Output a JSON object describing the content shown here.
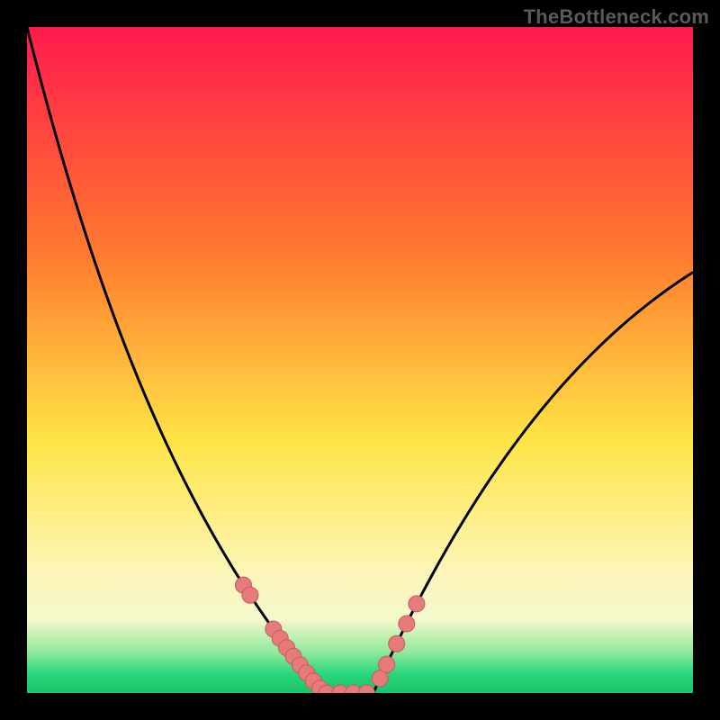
{
  "watermark": "TheBottleneck.com",
  "colors": {
    "top": "#ff1a4d",
    "mid1": "#ff7a2e",
    "mid2": "#ffe446",
    "pale1": "#fcf6b8",
    "pale2": "#f4f8cc",
    "green1": "#8de89a",
    "green2": "#2bd77d",
    "bottom": "#18c46a",
    "marker_fill": "#e77a7a",
    "marker_stroke": "#c75a57",
    "curve": "#000000"
  },
  "chart_data": {
    "type": "line",
    "title": "",
    "xlabel": "",
    "ylabel": "",
    "xlim": [
      0,
      100
    ],
    "ylim": [
      0,
      100
    ],
    "grid": false,
    "x": [
      0,
      1,
      2,
      3,
      4,
      5,
      6,
      7,
      8,
      9,
      10,
      11,
      12,
      13,
      14,
      15,
      16,
      17,
      18,
      19,
      20,
      21,
      22,
      23,
      24,
      25,
      26,
      27,
      28,
      29,
      30,
      31,
      32,
      33,
      34,
      35,
      36,
      37,
      38,
      39,
      40,
      41,
      42,
      43,
      44,
      45,
      46,
      47,
      48,
      49,
      50,
      51,
      52,
      53,
      54,
      55,
      56,
      57,
      58,
      59,
      60,
      61,
      62,
      63,
      64,
      65,
      66,
      67,
      68,
      69,
      70,
      71,
      72,
      73,
      74,
      75,
      76,
      77,
      78,
      79,
      80,
      81,
      82,
      83,
      84,
      85,
      86,
      87,
      88,
      89,
      90,
      91,
      92,
      93,
      94,
      95,
      96,
      97,
      98,
      99,
      100
    ],
    "left_curve_y": [
      100.0,
      96.05,
      92.22,
      88.49,
      84.88,
      81.36,
      77.95,
      74.64,
      71.42,
      68.3,
      65.27,
      62.33,
      59.48,
      56.71,
      54.02,
      51.42,
      48.89,
      46.43,
      44.05,
      41.74,
      39.49,
      37.31,
      35.19,
      33.13,
      31.14,
      29.19,
      27.3,
      25.47,
      23.68,
      21.94,
      20.25,
      18.6,
      17.0,
      15.43,
      13.91,
      12.42,
      10.98,
      9.56,
      8.19,
      6.84,
      5.53,
      4.25,
      3.0,
      1.79,
      0.6,
      0.0,
      0.0,
      0.0,
      0.0,
      0.0,
      0.0,
      0.0,
      0.0,
      0.0,
      0.0,
      0.0,
      0.0,
      0.0,
      0.0,
      0.0,
      0.0,
      0.0,
      0.0,
      0.0,
      0.0,
      0.0,
      0.0,
      0.0,
      0.0,
      0.0,
      0.0,
      0.0,
      0.0,
      0.0,
      0.0,
      0.0,
      0.0,
      0.0,
      0.0,
      0.0,
      0.0,
      0.0,
      0.0,
      0.0,
      0.0,
      0.0,
      0.0,
      0.0,
      0.0,
      0.0,
      0.0,
      0.0,
      0.0,
      0.0,
      0.0,
      0.0,
      0.0,
      0.0,
      0.0,
      0.0,
      0.0
    ],
    "right_curve_y": [
      0.0,
      0.0,
      0.0,
      0.0,
      0.0,
      0.0,
      0.0,
      0.0,
      0.0,
      0.0,
      0.0,
      0.0,
      0.0,
      0.0,
      0.0,
      0.0,
      0.0,
      0.0,
      0.0,
      0.0,
      0.0,
      0.0,
      0.0,
      0.0,
      0.0,
      0.0,
      0.0,
      0.0,
      0.0,
      0.0,
      0.0,
      0.0,
      0.0,
      0.0,
      0.0,
      0.0,
      0.0,
      0.0,
      0.0,
      0.0,
      0.0,
      0.0,
      0.0,
      0.0,
      0.0,
      0.0,
      0.0,
      0.0,
      0.0,
      0.0,
      0.0,
      0.0,
      0.0,
      2.17,
      4.3,
      6.39,
      8.43,
      10.44,
      12.4,
      14.32,
      16.2,
      18.04,
      19.84,
      21.6,
      23.32,
      25.0,
      26.64,
      28.24,
      29.8,
      31.32,
      32.81,
      34.26,
      35.67,
      37.05,
      38.4,
      39.71,
      40.99,
      42.24,
      43.45,
      44.64,
      45.79,
      46.91,
      48.0,
      49.07,
      50.1,
      51.11,
      52.09,
      53.04,
      53.97,
      54.87,
      55.74,
      56.59,
      57.41,
      58.21,
      58.99,
      59.74,
      60.47,
      61.18,
      61.87,
      62.53,
      63.18
    ],
    "markers": [
      {
        "x": 32.5,
        "y": 16.2
      },
      {
        "x": 33.5,
        "y": 14.7
      },
      {
        "x": 37.0,
        "y": 9.6
      },
      {
        "x": 38.0,
        "y": 8.2
      },
      {
        "x": 39.0,
        "y": 6.8
      },
      {
        "x": 40.0,
        "y": 5.5
      },
      {
        "x": 41.0,
        "y": 4.2
      },
      {
        "x": 42.0,
        "y": 3.0
      },
      {
        "x": 43.0,
        "y": 1.8
      },
      {
        "x": 44.0,
        "y": 0.7
      },
      {
        "x": 45.0,
        "y": 0.0
      },
      {
        "x": 47.0,
        "y": 0.0
      },
      {
        "x": 49.0,
        "y": 0.0
      },
      {
        "x": 51.0,
        "y": 0.0
      },
      {
        "x": 53.0,
        "y": 2.2
      },
      {
        "x": 54.0,
        "y": 4.3
      },
      {
        "x": 55.5,
        "y": 7.4
      },
      {
        "x": 57.0,
        "y": 10.4
      },
      {
        "x": 58.5,
        "y": 13.4
      }
    ],
    "gradient_stops": [
      {
        "pos": 0.0,
        "color": "top"
      },
      {
        "pos": 0.34,
        "color": "mid1"
      },
      {
        "pos": 0.62,
        "color": "mid2"
      },
      {
        "pos": 0.82,
        "color": "pale1"
      },
      {
        "pos": 0.89,
        "color": "pale2"
      },
      {
        "pos": 0.94,
        "color": "green1"
      },
      {
        "pos": 0.97,
        "color": "green2"
      },
      {
        "pos": 1.0,
        "color": "bottom"
      }
    ]
  }
}
